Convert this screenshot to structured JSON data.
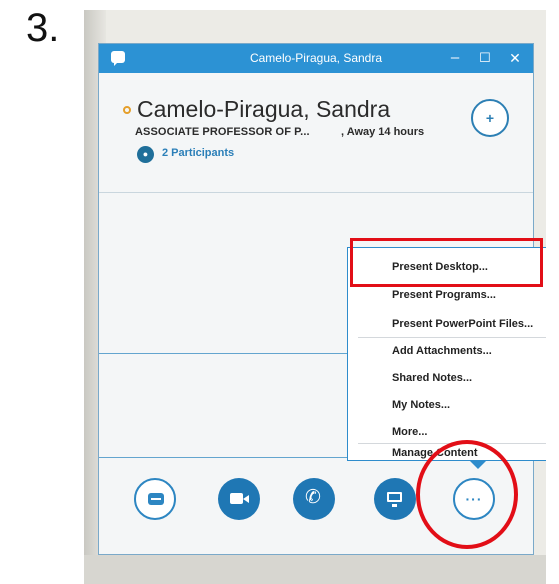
{
  "step": {
    "label": "3."
  },
  "window": {
    "title": "Camelo-Piragua, Sandra",
    "controls": {
      "minimize": "–",
      "maximize": "☐",
      "close": "✕"
    }
  },
  "contact": {
    "name": "Camelo-Piragua, Sandra",
    "title": "ASSOCIATE PROFESSOR OF P...",
    "status": ", Away 14 hours",
    "participants": "2 Participants"
  },
  "add_people_icon": "+",
  "present_menu": {
    "items": [
      {
        "label": "Present Desktop..."
      },
      {
        "label": "Present Programs..."
      },
      {
        "label": "Present PowerPoint Files..."
      },
      {
        "label": "Add Attachments..."
      },
      {
        "label": "Shared Notes..."
      },
      {
        "label": "My Notes..."
      },
      {
        "label": "More..."
      },
      {
        "label": "Manage Content"
      }
    ]
  },
  "toolbar": {
    "more_label": "···",
    "buttons": [
      "im-button",
      "video-button",
      "call-button",
      "present-button",
      "more-options-button"
    ]
  },
  "colors": {
    "accent": "#2c92d4",
    "annotation": "#e20e17"
  }
}
